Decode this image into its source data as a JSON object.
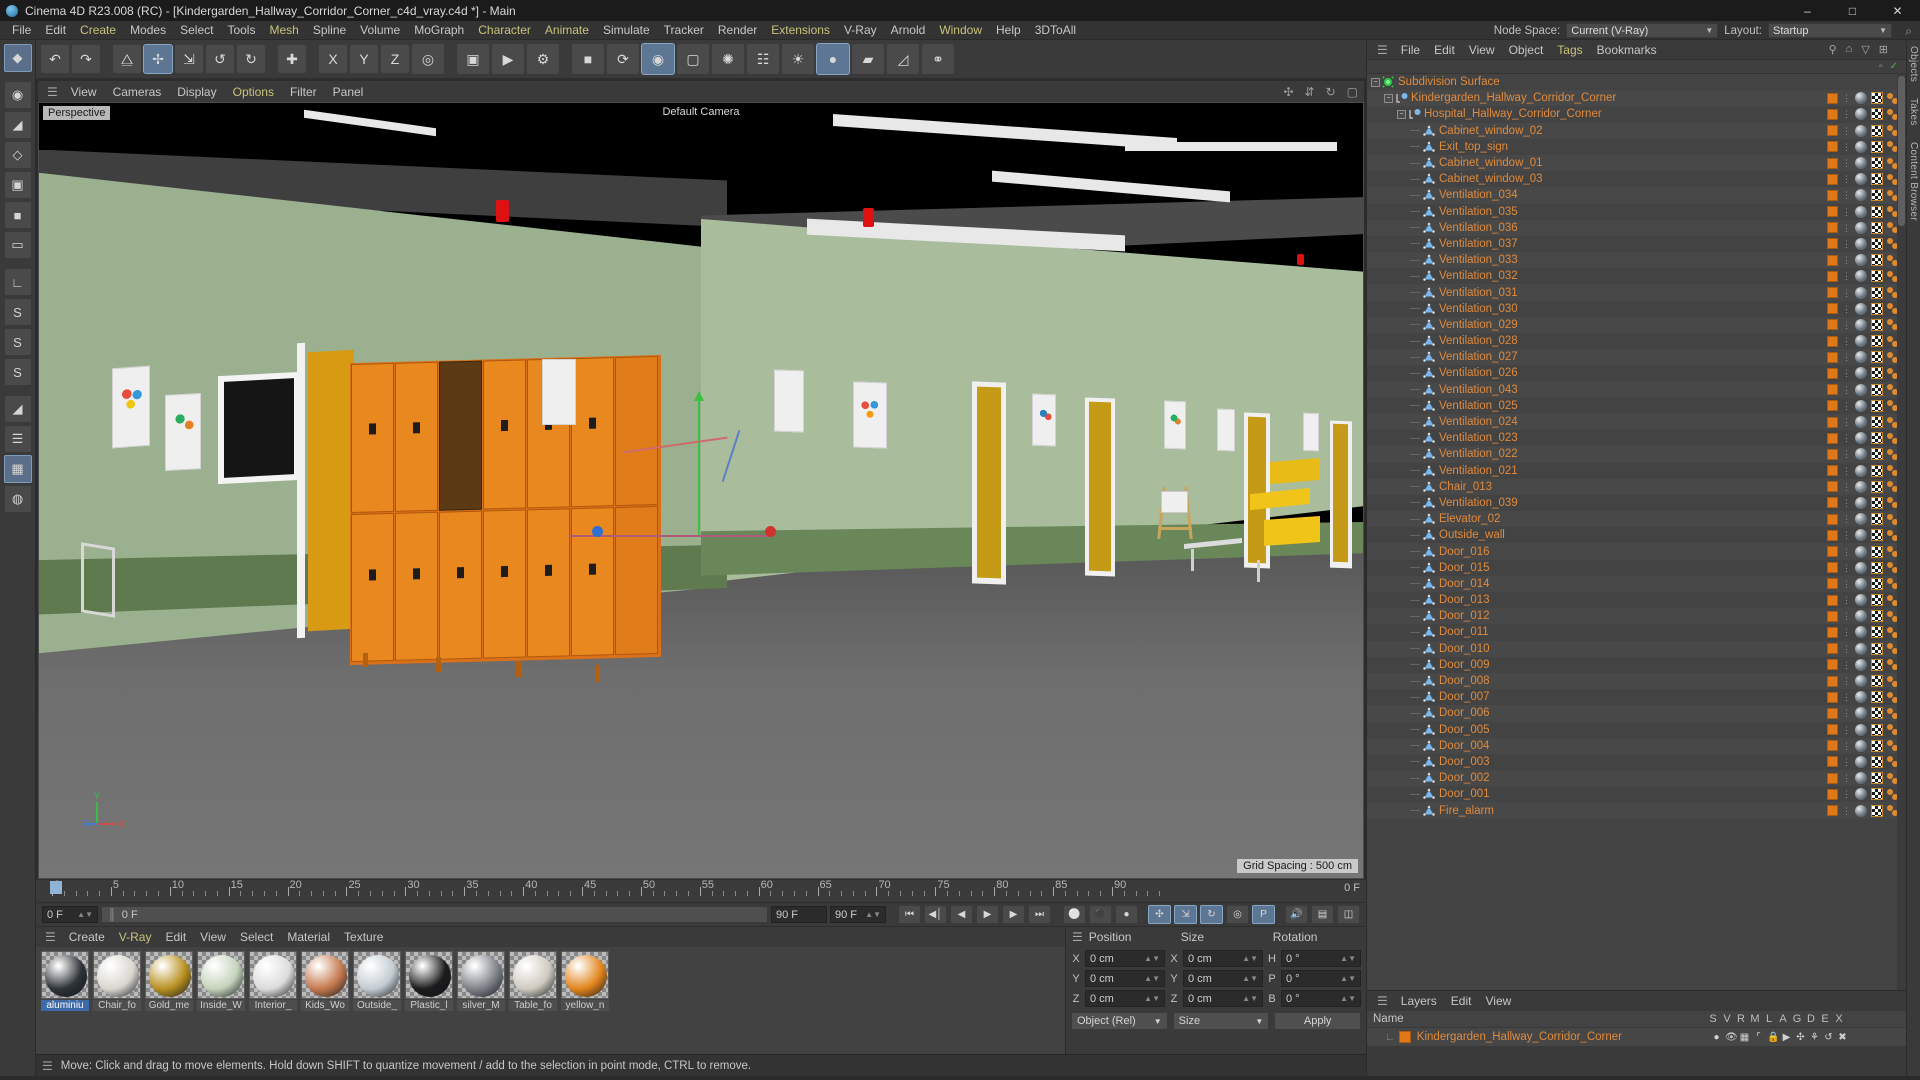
{
  "titlebar": {
    "title": "Cinema 4D R23.008 (RC) - [Kindergarden_Hallway_Corridor_Corner_c4d_vray.c4d *] - Main",
    "minimize": "–",
    "maximize": "□",
    "close": "✕"
  },
  "menubar": {
    "items": [
      {
        "label": "File",
        "accent": false
      },
      {
        "label": "Edit",
        "accent": false
      },
      {
        "label": "Create",
        "accent": true
      },
      {
        "label": "Modes",
        "accent": false
      },
      {
        "label": "Select",
        "accent": false
      },
      {
        "label": "Tools",
        "accent": false
      },
      {
        "label": "Mesh",
        "accent": true
      },
      {
        "label": "Spline",
        "accent": false
      },
      {
        "label": "Volume",
        "accent": false
      },
      {
        "label": "MoGraph",
        "accent": false
      },
      {
        "label": "Character",
        "accent": true
      },
      {
        "label": "Animate",
        "accent": true
      },
      {
        "label": "Simulate",
        "accent": false
      },
      {
        "label": "Tracker",
        "accent": false
      },
      {
        "label": "Render",
        "accent": false
      },
      {
        "label": "Extensions",
        "accent": true
      },
      {
        "label": "V-Ray",
        "accent": false
      },
      {
        "label": "Arnold",
        "accent": false
      },
      {
        "label": "Window",
        "accent": true
      },
      {
        "label": "Help",
        "accent": false
      },
      {
        "label": "3DToAll",
        "accent": false
      }
    ],
    "node_space_label": "Node Space:",
    "node_space_value": "Current (V-Ray)",
    "layout_label": "Layout:",
    "layout_value": "Startup",
    "search_icon": "⌕"
  },
  "viewport": {
    "menu": [
      "View",
      "Cameras",
      "Display",
      "Options",
      "Filter",
      "Panel"
    ],
    "menu_accent": [
      "Options"
    ],
    "label": "Perspective",
    "camera_label": "Default Camera",
    "grid_spacing": "Grid Spacing : 500 cm",
    "axis": {
      "x": "X",
      "y": "Y",
      "z": "Z"
    },
    "nav_icons": [
      "move-icon",
      "scale-icon",
      "rotate-icon",
      "frame-icon"
    ]
  },
  "timeline": {
    "ticks": [
      0,
      5,
      10,
      15,
      20,
      25,
      30,
      35,
      40,
      45,
      50,
      55,
      60,
      65,
      70,
      75,
      80,
      85,
      90
    ],
    "current_frame": "0 F",
    "start_field": "0 F",
    "playhead_field": "0 F",
    "end_field": "90 F",
    "end_field2": "90 F"
  },
  "materials": {
    "menu": [
      "Create",
      "V-Ray",
      "Edit",
      "View",
      "Select",
      "Material",
      "Texture"
    ],
    "menu_accent": [
      "V-Ray"
    ],
    "items": [
      {
        "name": "aluminiu",
        "full": "aluminium",
        "color": "#2e3338",
        "selected": true
      },
      {
        "name": "Chair_fo",
        "full": "Chair_foam",
        "color": "#d9d6cf",
        "selected": false
      },
      {
        "name": "Gold_me",
        "full": "Gold_metal",
        "color": "#b89020",
        "selected": false
      },
      {
        "name": "Inside_W",
        "full": "Inside_Wall",
        "color": "#c5d3bb",
        "selected": false
      },
      {
        "name": "Interior_",
        "full": "Interior_glass",
        "color": "#dcdcdc",
        "selected": false
      },
      {
        "name": "Kids_Wo",
        "full": "Kids_Wall_art",
        "color": "#c4794e",
        "selected": false
      },
      {
        "name": "Outside_",
        "full": "Outside_Wall",
        "color": "#c3ccd2",
        "selected": false
      },
      {
        "name": "Plastic_l",
        "full": "Plastic_black",
        "color": "#1c1c1c",
        "selected": false
      },
      {
        "name": "silver_M",
        "full": "silver_Metal",
        "color": "#7e8288",
        "selected": false
      },
      {
        "name": "Table_fo",
        "full": "Table_form",
        "color": "#cfcabf",
        "selected": false
      },
      {
        "name": "yellow_n",
        "full": "yellow_metal",
        "color": "#e2841c",
        "selected": false
      }
    ]
  },
  "coordinates": {
    "headers": {
      "position": "Position",
      "size": "Size",
      "rotation": "Rotation"
    },
    "rows": [
      {
        "axis1": "X",
        "val1": "0 cm",
        "axis2": "X",
        "val2": "0 cm",
        "axis3": "H",
        "val3": "0 °"
      },
      {
        "axis1": "Y",
        "val1": "0 cm",
        "axis2": "Y",
        "val2": "0 cm",
        "axis3": "P",
        "val3": "0 °"
      },
      {
        "axis1": "Z",
        "val1": "0 cm",
        "axis2": "Z",
        "val2": "0 cm",
        "axis3": "B",
        "val3": "0 °"
      }
    ],
    "mode_select": "Object (Rel)",
    "size_select": "Size",
    "apply_button": "Apply"
  },
  "statusbar": {
    "message": "Move: Click and drag to move elements. Hold down SHIFT to quantize movement / add to the selection in point mode, CTRL to remove."
  },
  "object_manager": {
    "menu": [
      "File",
      "Edit",
      "View",
      "Object",
      "Tags",
      "Bookmarks"
    ],
    "menu_accent": [
      "Tags"
    ],
    "icons": [
      "search-icon",
      "home-icon",
      "filter-icon",
      "add-icon"
    ],
    "objects": [
      {
        "name": "Subdivision Surface",
        "depth": 0,
        "type": "subdiv",
        "expand": true,
        "tags": false
      },
      {
        "name": "Kindergarden_Hallway_Corridor_Corner",
        "depth": 1,
        "type": "null",
        "expand": true,
        "tags": true
      },
      {
        "name": "Hospital_Hallway_Corridor_Corner",
        "depth": 2,
        "type": "null",
        "expand": true,
        "tags": true
      },
      {
        "name": "Cabinet_window_02",
        "depth": 3,
        "type": "poly",
        "tags": true
      },
      {
        "name": "Exit_top_sign",
        "depth": 3,
        "type": "poly",
        "tags": true
      },
      {
        "name": "Cabinet_window_01",
        "depth": 3,
        "type": "poly",
        "tags": true
      },
      {
        "name": "Cabinet_window_03",
        "depth": 3,
        "type": "poly",
        "tags": true
      },
      {
        "name": "Ventilation_034",
        "depth": 3,
        "type": "poly",
        "tags": true
      },
      {
        "name": "Ventilation_035",
        "depth": 3,
        "type": "poly",
        "tags": true
      },
      {
        "name": "Ventilation_036",
        "depth": 3,
        "type": "poly",
        "tags": true
      },
      {
        "name": "Ventilation_037",
        "depth": 3,
        "type": "poly",
        "tags": true
      },
      {
        "name": "Ventilation_033",
        "depth": 3,
        "type": "poly",
        "tags": true
      },
      {
        "name": "Ventilation_032",
        "depth": 3,
        "type": "poly",
        "tags": true
      },
      {
        "name": "Ventilation_031",
        "depth": 3,
        "type": "poly",
        "tags": true
      },
      {
        "name": "Ventilation_030",
        "depth": 3,
        "type": "poly",
        "tags": true
      },
      {
        "name": "Ventilation_029",
        "depth": 3,
        "type": "poly",
        "tags": true
      },
      {
        "name": "Ventilation_028",
        "depth": 3,
        "type": "poly",
        "tags": true
      },
      {
        "name": "Ventilation_027",
        "depth": 3,
        "type": "poly",
        "tags": true
      },
      {
        "name": "Ventilation_026",
        "depth": 3,
        "type": "poly",
        "tags": true
      },
      {
        "name": "Ventilation_043",
        "depth": 3,
        "type": "poly",
        "tags": true
      },
      {
        "name": "Ventilation_025",
        "depth": 3,
        "type": "poly",
        "tags": true
      },
      {
        "name": "Ventilation_024",
        "depth": 3,
        "type": "poly",
        "tags": true
      },
      {
        "name": "Ventilation_023",
        "depth": 3,
        "type": "poly",
        "tags": true
      },
      {
        "name": "Ventilation_022",
        "depth": 3,
        "type": "poly",
        "tags": true
      },
      {
        "name": "Ventilation_021",
        "depth": 3,
        "type": "poly",
        "tags": true
      },
      {
        "name": "Chair_013",
        "depth": 3,
        "type": "poly",
        "tags": true
      },
      {
        "name": "Ventilation_039",
        "depth": 3,
        "type": "poly",
        "tags": true
      },
      {
        "name": "Elevator_02",
        "depth": 3,
        "type": "poly",
        "tags": true
      },
      {
        "name": "Outside_wall",
        "depth": 3,
        "type": "poly",
        "tags": true
      },
      {
        "name": "Door_016",
        "depth": 3,
        "type": "poly",
        "tags": true
      },
      {
        "name": "Door_015",
        "depth": 3,
        "type": "poly",
        "tags": true
      },
      {
        "name": "Door_014",
        "depth": 3,
        "type": "poly",
        "tags": true
      },
      {
        "name": "Door_013",
        "depth": 3,
        "type": "poly",
        "tags": true
      },
      {
        "name": "Door_012",
        "depth": 3,
        "type": "poly",
        "tags": true
      },
      {
        "name": "Door_011",
        "depth": 3,
        "type": "poly",
        "tags": true
      },
      {
        "name": "Door_010",
        "depth": 3,
        "type": "poly",
        "tags": true
      },
      {
        "name": "Door_009",
        "depth": 3,
        "type": "poly",
        "tags": true
      },
      {
        "name": "Door_008",
        "depth": 3,
        "type": "poly",
        "tags": true
      },
      {
        "name": "Door_007",
        "depth": 3,
        "type": "poly",
        "tags": true
      },
      {
        "name": "Door_006",
        "depth": 3,
        "type": "poly",
        "tags": true
      },
      {
        "name": "Door_005",
        "depth": 3,
        "type": "poly",
        "tags": true
      },
      {
        "name": "Door_004",
        "depth": 3,
        "type": "poly",
        "tags": true
      },
      {
        "name": "Door_003",
        "depth": 3,
        "type": "poly",
        "tags": true
      },
      {
        "name": "Door_002",
        "depth": 3,
        "type": "poly",
        "tags": true
      },
      {
        "name": "Door_001",
        "depth": 3,
        "type": "poly",
        "tags": true
      },
      {
        "name": "Fire_alarm",
        "depth": 3,
        "type": "poly",
        "tags": true
      }
    ]
  },
  "layers": {
    "menu": [
      "Layers",
      "Edit",
      "View"
    ],
    "name_header": "Name",
    "columns": [
      "S",
      "V",
      "R",
      "M",
      "L",
      "A",
      "G",
      "D",
      "E",
      "X"
    ],
    "rows": [
      {
        "name": "Kindergarden_Hallway_Corridor_Corner",
        "color": "#e07818"
      }
    ]
  },
  "right_tabs": [
    "Objects",
    "Takes",
    "Content Browser"
  ]
}
